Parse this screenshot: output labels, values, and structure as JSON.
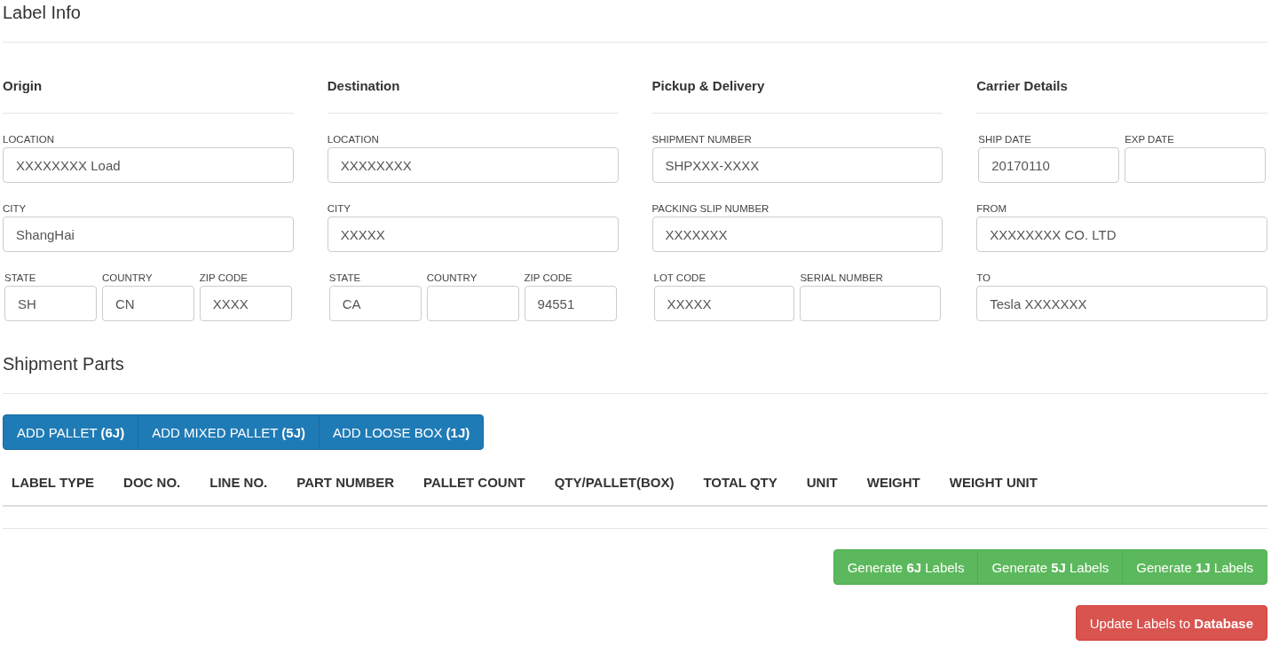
{
  "title": "Label Info",
  "columns": [
    {
      "heading": "Origin",
      "rows": [
        [
          {
            "label": "LOCATION",
            "value": "XXXXXXXX Load"
          }
        ],
        [
          {
            "label": "CITY",
            "value": "ShangHai"
          }
        ],
        [
          {
            "label": "STATE",
            "value": "SH"
          },
          {
            "label": "COUNTRY",
            "value": "CN"
          },
          {
            "label": "ZIP CODE",
            "value": "XXXX"
          }
        ]
      ]
    },
    {
      "heading": "Destination",
      "rows": [
        [
          {
            "label": "LOCATION",
            "value": "XXXXXXXX"
          }
        ],
        [
          {
            "label": "CITY",
            "value": "XXXXX"
          }
        ],
        [
          {
            "label": "STATE",
            "value": "CA"
          },
          {
            "label": "COUNTRY"
          },
          {
            "label": "ZIP CODE",
            "value": "94551"
          }
        ]
      ]
    },
    {
      "heading": "Pickup & Delivery",
      "rows": [
        [
          {
            "label": "SHIPMENT NUMBER",
            "value": "SHPXXX-XXXX"
          }
        ],
        [
          {
            "label": "PACKING SLIP NUMBER",
            "value": "XXXXXXX"
          }
        ],
        [
          {
            "label": "LOT CODE",
            "value": "XXXXX"
          },
          {
            "label": "SERIAL NUMBER"
          }
        ]
      ]
    },
    {
      "heading": "Carrier Details",
      "rows": [
        [
          {
            "label": "SHIP DATE",
            "value": "20170110"
          },
          {
            "label": "EXP DATE"
          }
        ],
        [
          {
            "label": "FROM",
            "value": "XXXXXXXX CO. LTD"
          }
        ],
        [
          {
            "label": "TO",
            "value": "Tesla XXXXXXX"
          }
        ]
      ]
    }
  ],
  "parts_title": "Shipment Parts",
  "add_buttons": [
    "ADD PALLET **(6J)**",
    "ADD MIXED PALLET **(5J)**",
    "ADD LOOSE BOX **(1J)**"
  ],
  "table": {
    "columns": [
      "LABEL TYPE",
      "DOC NO.",
      "LINE NO.",
      "PART NUMBER",
      "PALLET COUNT",
      "QTY/PALLET(BOX)",
      "TOTAL QTY",
      "UNIT",
      "WEIGHT",
      "WEIGHT UNIT"
    ]
  },
  "generate_buttons": [
    "Generate **6J** Labels",
    "Generate **5J** Labels",
    "Generate **1J** Labels"
  ],
  "update_button": "Update Labels to **Database**"
}
